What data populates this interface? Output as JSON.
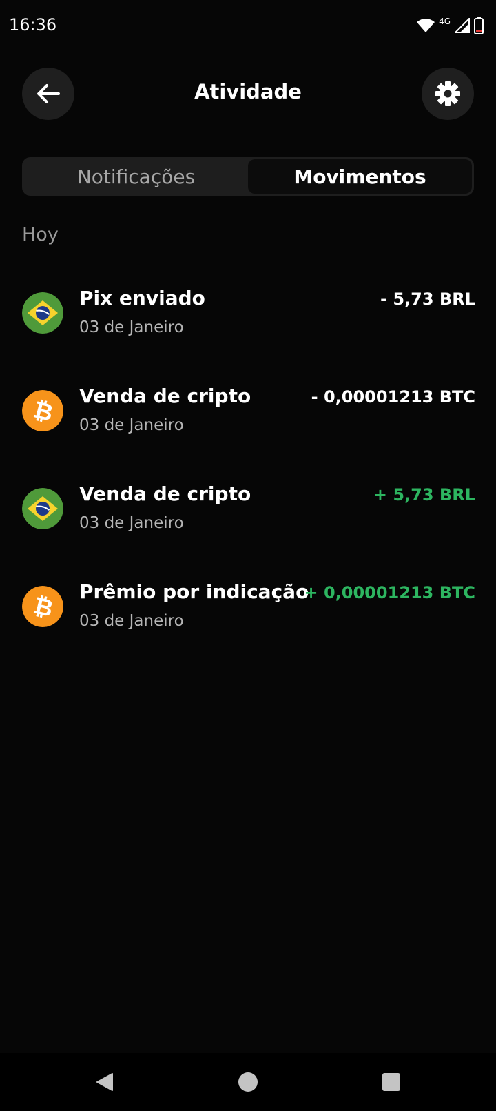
{
  "status_bar": {
    "time": "16:36",
    "network": "4G"
  },
  "header": {
    "title": "Atividade"
  },
  "tabs": [
    {
      "label": "Notificações",
      "active": false
    },
    {
      "label": "Movimentos",
      "active": true
    }
  ],
  "section": {
    "label": "Hoy"
  },
  "transactions": [
    {
      "title": "Pix enviado",
      "date": "03 de Janeiro",
      "amount": "- 5,73 BRL",
      "icon": "brazil-flag-icon",
      "sign": "negative"
    },
    {
      "title": "Venda de cripto",
      "date": "03 de Janeiro",
      "amount": "- 0,00001213 BTC",
      "icon": "bitcoin-icon",
      "sign": "negative"
    },
    {
      "title": "Venda de cripto",
      "date": "03 de Janeiro",
      "amount": "+ 5,73 BRL",
      "icon": "brazil-flag-icon",
      "sign": "positive"
    },
    {
      "title": "Prêmio por indicação",
      "date": "03 de Janeiro",
      "amount": "+ 0,00001213 BTC",
      "icon": "bitcoin-icon",
      "sign": "positive"
    }
  ],
  "colors": {
    "positive": "#2db560",
    "negative": "#ffffff",
    "bitcoin": "#f7931a",
    "background": "#060606"
  }
}
